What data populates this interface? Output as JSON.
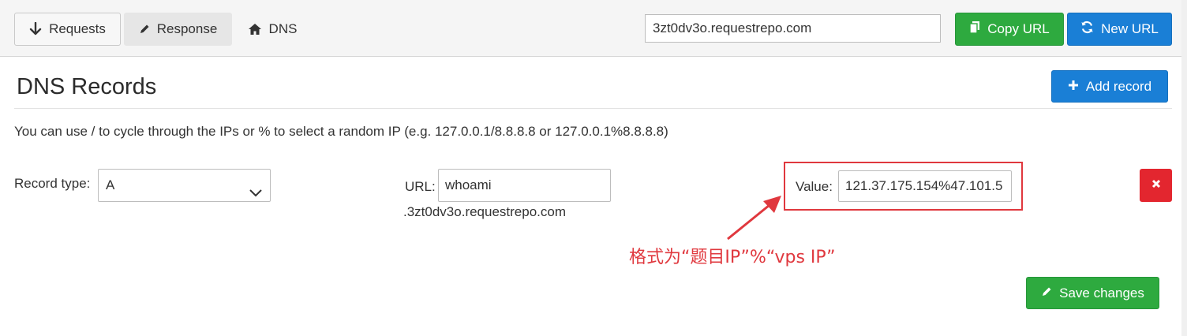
{
  "topbar": {
    "tabs": [
      {
        "label": "Requests",
        "icon": "arrow-down-icon"
      },
      {
        "label": "Response",
        "icon": "pencil-icon"
      },
      {
        "label": "DNS",
        "icon": "home-icon"
      }
    ],
    "url": "3zt0dv3o.requestrepo.com",
    "copy_label": "Copy URL",
    "new_label": "New URL"
  },
  "main": {
    "title": "DNS Records",
    "add_label": "Add record",
    "info": "You can use / to cycle through the IPs or % to select a random IP (e.g. 127.0.0.1/8.8.8.8 or 127.0.0.1%8.8.8.8)",
    "record": {
      "type_label": "Record type:",
      "type_value": "A",
      "url_label": "URL:",
      "url_value": "whoami",
      "url_suffix": ".3zt0dv3o.requestrepo.com",
      "value_label": "Value:",
      "value_value": "121.37.175.154%47.101.5"
    },
    "annotation": "格式为“题目IP”%“vps IP”",
    "save_label": "Save changes"
  },
  "colors": {
    "green": "#2eaa3f",
    "blue": "#1a7fd6",
    "red": "#e3262f",
    "annotation": "#e0383e"
  }
}
